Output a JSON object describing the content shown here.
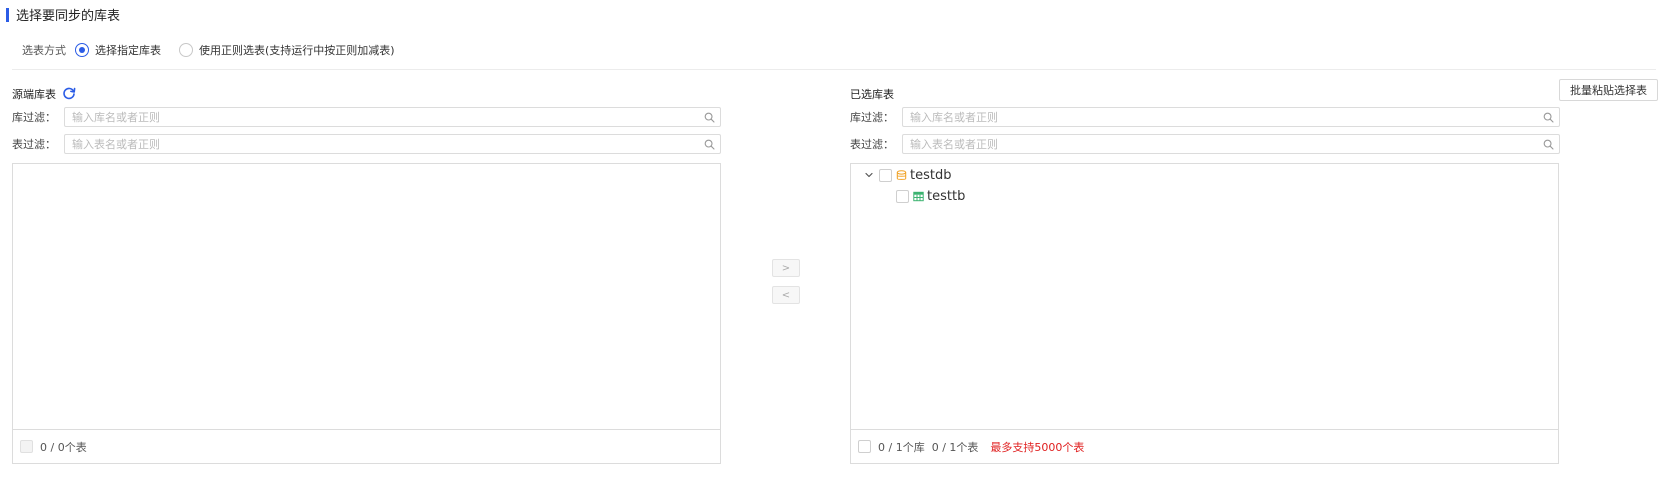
{
  "section": {
    "title": "选择要同步的库表",
    "accent": "#2b5ce6"
  },
  "mode": {
    "label": "选表方式",
    "options": [
      {
        "label": "选择指定库表",
        "checked": true
      },
      {
        "label": "使用正则选表(支持运行中按正则加减表)",
        "checked": false
      }
    ]
  },
  "source": {
    "title": "源端库表",
    "refresh_icon": "refresh-icon",
    "db_filter_label": "库过滤：",
    "db_filter_placeholder": "输入库名或者正则",
    "tb_filter_label": "表过滤：",
    "tb_filter_placeholder": "输入表名或者正则",
    "footer": "0 / 0个表"
  },
  "transfer": {
    "right": ">",
    "left": "<"
  },
  "selected": {
    "title": "已选库表",
    "batch_button": "批量粘贴选择表",
    "db_filter_label": "库过滤：",
    "db_filter_placeholder": "输入库名或者正则",
    "tb_filter_label": "表过滤：",
    "tb_filter_placeholder": "输入表名或者正则",
    "tree": {
      "db": "testdb",
      "table": "testtb"
    },
    "footer_db": "0 / 1个库",
    "footer_tb": "0 / 1个表",
    "footer_warn": "最多支持5000个表",
    "warn_color": "#e02020"
  }
}
